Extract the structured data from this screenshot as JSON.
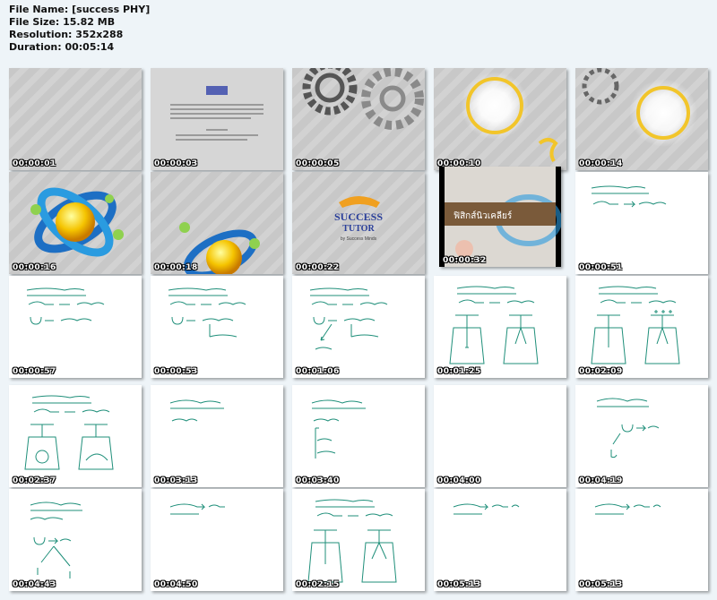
{
  "header": {
    "file_name": "File Name: [success PHY]",
    "file_size": "File Size: 15.82 MB",
    "resolution": "Resolution: 352x288",
    "duration": "Duration: 00:05:14"
  },
  "thumbnails": [
    {
      "time": "00:00:01",
      "scene": "gray-stripes"
    },
    {
      "time": "00:00:03",
      "scene": "warning-text"
    },
    {
      "time": "00:00:05",
      "scene": "gears"
    },
    {
      "time": "00:00:10",
      "scene": "light-burst"
    },
    {
      "time": "00:00:14",
      "scene": "light-burst-2"
    },
    {
      "time": "00:00:16",
      "scene": "atom-logo"
    },
    {
      "time": "00:00:18",
      "scene": "atom-logo-2"
    },
    {
      "time": "00:00:22",
      "scene": "success-tutor-logo"
    },
    {
      "time": "00:00:32",
      "scene": "title-card"
    },
    {
      "time": "00:00:51",
      "scene": "whiteboard"
    },
    {
      "time": "00:00:57",
      "scene": "whiteboard"
    },
    {
      "time": "00:00:53",
      "scene": "whiteboard"
    },
    {
      "time": "00:01:06",
      "scene": "whiteboard"
    },
    {
      "time": "00:01:25",
      "scene": "whiteboard"
    },
    {
      "time": "00:02:09",
      "scene": "whiteboard"
    },
    {
      "time": "00:02:37",
      "scene": "whiteboard"
    },
    {
      "time": "00:03:13",
      "scene": "whiteboard"
    },
    {
      "time": "00:03:40",
      "scene": "whiteboard"
    },
    {
      "time": "00:04:00",
      "scene": "whiteboard"
    },
    {
      "time": "00:04:19",
      "scene": "whiteboard"
    },
    {
      "time": "00:04:43",
      "scene": "whiteboard"
    },
    {
      "time": "00:04:50",
      "scene": "whiteboard"
    },
    {
      "time": "00:02:15",
      "scene": "whiteboard"
    },
    {
      "time": "00:05:13",
      "scene": "whiteboard"
    },
    {
      "time": "00:05:13",
      "scene": "whiteboard"
    }
  ],
  "logo": {
    "success": "SUCCESS",
    "tutor": "TUTOR",
    "byline": "by Success Minds"
  },
  "title_card": {
    "title": "ฟิสิกส์นิวเคลียร์"
  },
  "colors": {
    "page_bg": "#eef4f8",
    "ink": "#1f8f7a",
    "title_bar": "#7a5a3a",
    "logo_blue": "#2a3f9a"
  }
}
